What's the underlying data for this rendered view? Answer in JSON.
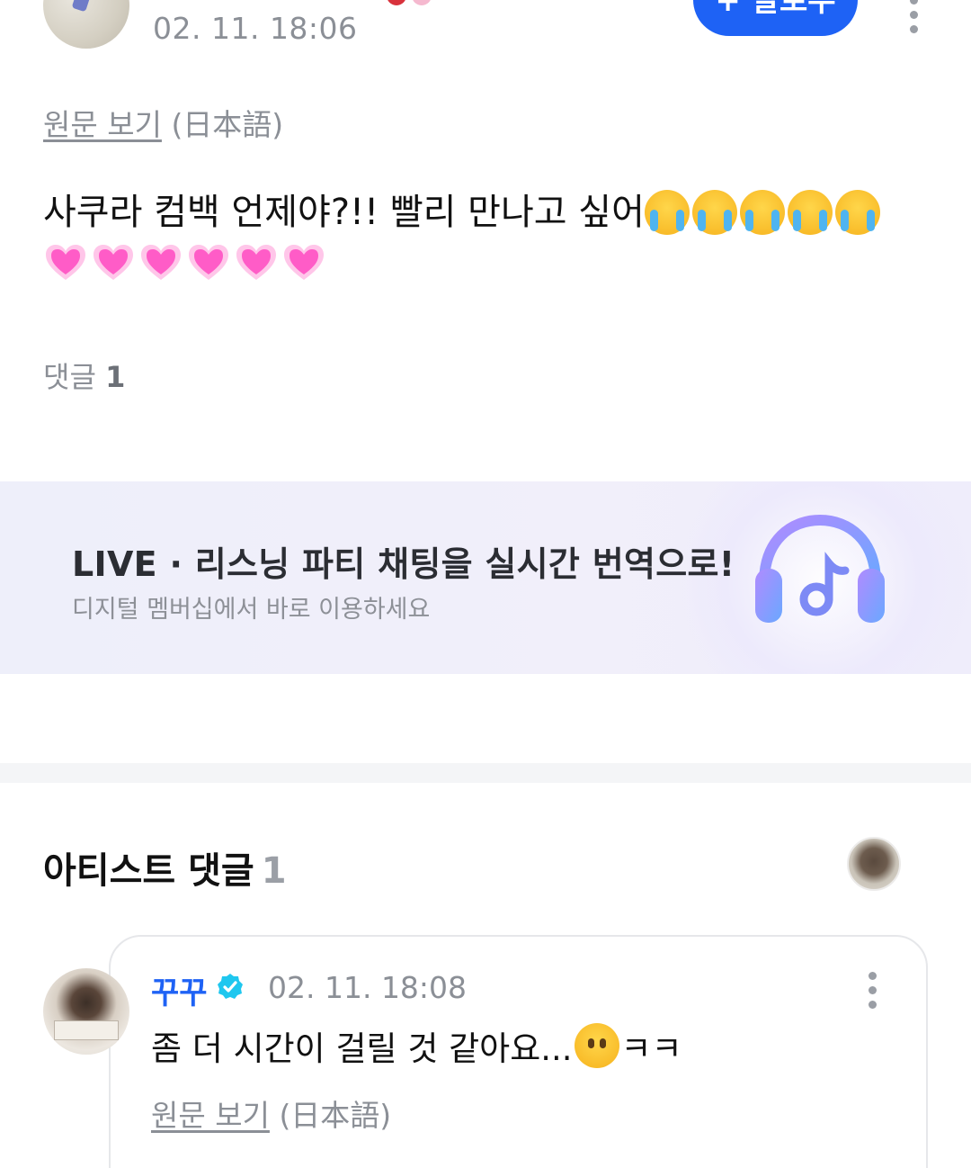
{
  "post": {
    "timestamp": "02. 11. 18:06",
    "follow_label": "+ 팔로우",
    "view_original_link": "원문 보기",
    "view_original_language": "(日本語)",
    "body_text": "사쿠라 컴백 언제야?!! 빨리 만나고 싶어",
    "body_emoji": [
      "loudly-crying-face",
      "loudly-crying-face",
      "loudly-crying-face",
      "loudly-crying-face",
      "loudly-crying-face"
    ],
    "body_hearts": [
      "growing-heart",
      "growing-heart",
      "growing-heart",
      "growing-heart",
      "growing-heart",
      "growing-heart"
    ],
    "comment_label": "댓글",
    "comment_count": "1"
  },
  "banner": {
    "title": "LIVE · 리스닝 파티 채팅을 실시간 번역으로!",
    "subtitle": "디지털 멤버십에서 바로 이용하세요",
    "icon": "headphones-icon"
  },
  "artist_comments": {
    "heading": "아티스트 댓글",
    "count": "1",
    "comments": [
      {
        "author": "꾸꾸",
        "timestamp": "02. 11. 18:08",
        "text_before_emoji": "좀 더 시간이 걸릴 것 같아요...",
        "emoji": "face-without-mouth",
        "text_after_emoji": "ㅋㅋ",
        "view_original_link": "원문 보기",
        "view_original_language": "(日本語)"
      }
    ]
  },
  "colors": {
    "accent": "#1e62f5",
    "muted_text": "#8b8f96",
    "banner_bg": "#eeeffa"
  }
}
